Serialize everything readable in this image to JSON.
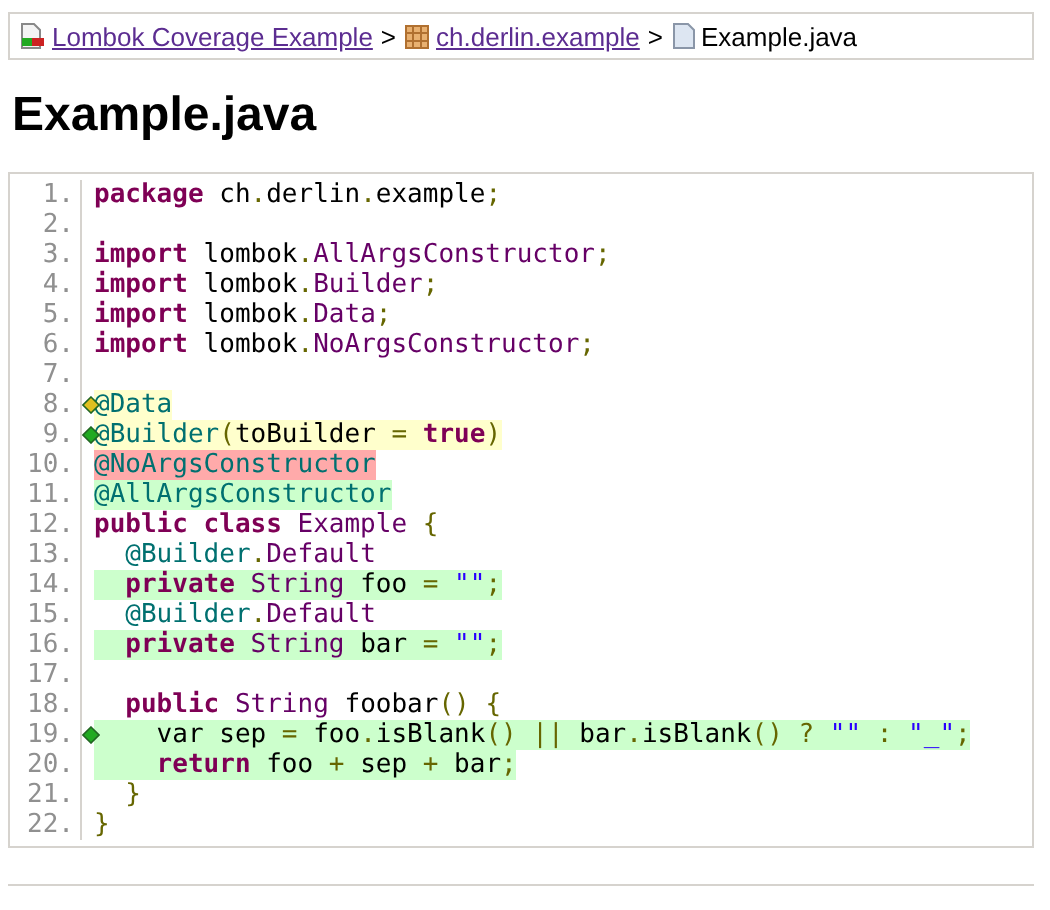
{
  "breadcrumb": [
    {
      "kind": "report",
      "label": "Lombok Coverage Example",
      "link": true
    },
    {
      "kind": "package",
      "label": "ch.derlin.example",
      "link": true
    },
    {
      "kind": "source",
      "label": "Example.java",
      "link": false
    }
  ],
  "separator": ">",
  "title": "Example.java",
  "lines": [
    {
      "number": "1.",
      "tokens": [
        {
          "kind": "kw",
          "text": "package"
        },
        {
          "kind": "pln",
          "text": " ch"
        },
        {
          "kind": "pun",
          "text": "."
        },
        {
          "kind": "pln",
          "text": "derlin"
        },
        {
          "kind": "pun",
          "text": "."
        },
        {
          "kind": "pln",
          "text": "example"
        },
        {
          "kind": "pun",
          "text": ";"
        }
      ]
    },
    {
      "number": "2."
    },
    {
      "number": "3.",
      "tokens": [
        {
          "kind": "kw",
          "text": "import"
        },
        {
          "kind": "pln",
          "text": " lombok"
        },
        {
          "kind": "pun",
          "text": "."
        },
        {
          "kind": "typ",
          "text": "AllArgsConstructor"
        },
        {
          "kind": "pun",
          "text": ";"
        }
      ]
    },
    {
      "number": "4.",
      "tokens": [
        {
          "kind": "kw",
          "text": "import"
        },
        {
          "kind": "pln",
          "text": " lombok"
        },
        {
          "kind": "pun",
          "text": "."
        },
        {
          "kind": "typ",
          "text": "Builder"
        },
        {
          "kind": "pun",
          "text": ";"
        }
      ]
    },
    {
      "number": "5.",
      "tokens": [
        {
          "kind": "kw",
          "text": "import"
        },
        {
          "kind": "pln",
          "text": " lombok"
        },
        {
          "kind": "pun",
          "text": "."
        },
        {
          "kind": "typ",
          "text": "Data"
        },
        {
          "kind": "pun",
          "text": ";"
        }
      ]
    },
    {
      "number": "6.",
      "tokens": [
        {
          "kind": "kw",
          "text": "import"
        },
        {
          "kind": "pln",
          "text": " lombok"
        },
        {
          "kind": "pun",
          "text": "."
        },
        {
          "kind": "typ",
          "text": "NoArgsConstructor"
        },
        {
          "kind": "pun",
          "text": ";"
        }
      ]
    },
    {
      "number": "7."
    },
    {
      "number": "8.",
      "kind": "partial",
      "branch": {
        "color": "#e0c020"
      },
      "tokens": [
        {
          "kind": "atn",
          "text": "@Data"
        }
      ]
    },
    {
      "number": "9.",
      "kind": "partial",
      "branch": {
        "color": "#22aa22"
      },
      "tokens": [
        {
          "kind": "atn",
          "text": "@Builder"
        },
        {
          "kind": "pun",
          "text": "("
        },
        {
          "kind": "pln",
          "text": "toBuilder "
        },
        {
          "kind": "pun",
          "text": "= "
        },
        {
          "kind": "kw",
          "text": "true"
        },
        {
          "kind": "pun",
          "text": ")"
        }
      ]
    },
    {
      "number": "10.",
      "kind": "missed",
      "tokens": [
        {
          "kind": "atn",
          "text": "@NoArgsConstructor"
        }
      ]
    },
    {
      "number": "11.",
      "kind": "covered",
      "tokens": [
        {
          "kind": "atn",
          "text": "@AllArgsConstructor"
        }
      ]
    },
    {
      "number": "12.",
      "tokens": [
        {
          "kind": "kw",
          "text": "public class "
        },
        {
          "kind": "typ",
          "text": "Example "
        },
        {
          "kind": "pun",
          "text": "{"
        }
      ]
    },
    {
      "number": "13.",
      "tokens": [
        {
          "kind": "atn",
          "text": "  @Builder"
        },
        {
          "kind": "pun",
          "text": "."
        },
        {
          "kind": "typ",
          "text": "Default"
        }
      ]
    },
    {
      "number": "14.",
      "kind": "covered",
      "tokens": [
        {
          "kind": "kw",
          "text": "  private "
        },
        {
          "kind": "typ",
          "text": "String"
        },
        {
          "kind": "pln",
          "text": " foo "
        },
        {
          "kind": "pun",
          "text": "= "
        },
        {
          "kind": "str",
          "text": "\"\""
        },
        {
          "kind": "pun",
          "text": ";"
        }
      ]
    },
    {
      "number": "15.",
      "tokens": [
        {
          "kind": "atn",
          "text": "  @Builder"
        },
        {
          "kind": "pun",
          "text": "."
        },
        {
          "kind": "typ",
          "text": "Default"
        }
      ]
    },
    {
      "number": "16.",
      "kind": "covered",
      "tokens": [
        {
          "kind": "kw",
          "text": "  private "
        },
        {
          "kind": "typ",
          "text": "String"
        },
        {
          "kind": "pln",
          "text": " bar "
        },
        {
          "kind": "pun",
          "text": "= "
        },
        {
          "kind": "str",
          "text": "\"\""
        },
        {
          "kind": "pun",
          "text": ";"
        }
      ]
    },
    {
      "number": "17."
    },
    {
      "number": "18.",
      "tokens": [
        {
          "kind": "kw",
          "text": "  public "
        },
        {
          "kind": "typ",
          "text": "String"
        },
        {
          "kind": "pln",
          "text": " foobar"
        },
        {
          "kind": "pun",
          "text": "() {"
        }
      ]
    },
    {
      "number": "19.",
      "kind": "covered",
      "branch": {
        "color": "#22aa22"
      },
      "tokens": [
        {
          "kind": "pln",
          "text": "    var sep "
        },
        {
          "kind": "pun",
          "text": "="
        },
        {
          "kind": "pln",
          "text": " foo"
        },
        {
          "kind": "pun",
          "text": "."
        },
        {
          "kind": "pln",
          "text": "isBlank"
        },
        {
          "kind": "pun",
          "text": "() || "
        },
        {
          "kind": "pln",
          "text": "bar"
        },
        {
          "kind": "pun",
          "text": "."
        },
        {
          "kind": "pln",
          "text": "isBlank"
        },
        {
          "kind": "pun",
          "text": "() ? "
        },
        {
          "kind": "str",
          "text": "\"\""
        },
        {
          "kind": "pun",
          "text": " : "
        },
        {
          "kind": "str",
          "text": "\"_\""
        },
        {
          "kind": "pun",
          "text": ";"
        }
      ]
    },
    {
      "number": "20.",
      "kind": "covered",
      "tokens": [
        {
          "kind": "kw",
          "text": "    return"
        },
        {
          "kind": "pln",
          "text": " foo "
        },
        {
          "kind": "pun",
          "text": "+"
        },
        {
          "kind": "pln",
          "text": " sep "
        },
        {
          "kind": "pun",
          "text": "+"
        },
        {
          "kind": "pln",
          "text": " bar"
        },
        {
          "kind": "pun",
          "text": ";"
        }
      ]
    },
    {
      "number": "21.",
      "tokens": [
        {
          "kind": "pun",
          "text": "  }"
        }
      ]
    },
    {
      "number": "22.",
      "tokens": [
        {
          "kind": "pun",
          "text": "}"
        }
      ]
    }
  ]
}
